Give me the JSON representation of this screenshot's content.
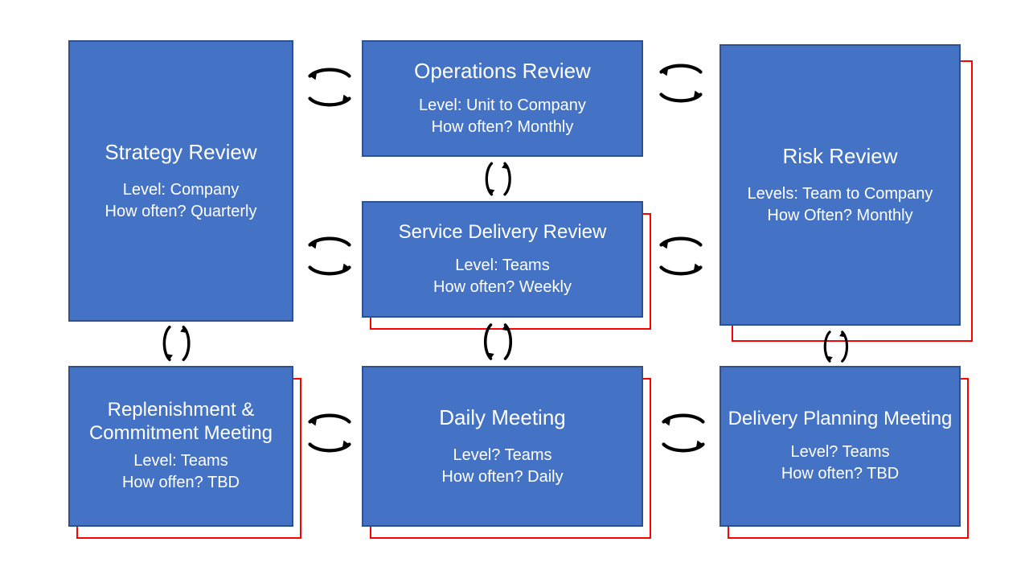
{
  "boxes": {
    "strategy": {
      "title": "Strategy Review",
      "level": "Level: Company",
      "often": "How often? Quarterly"
    },
    "operations": {
      "title": "Operations Review",
      "level": "Level: Unit to Company",
      "often": "How often? Monthly"
    },
    "service": {
      "title": "Service Delivery Review",
      "level": "Level: Teams",
      "often": "How often? Weekly"
    },
    "risk": {
      "title": "Risk Review",
      "level": "Levels: Team to Company",
      "often": "How Often? Monthly"
    },
    "replenish": {
      "title": "Replenishment & Commitment Meeting",
      "level": "Level: Teams",
      "often": "How offen? TBD"
    },
    "daily": {
      "title": "Daily Meeting",
      "level": "Level? Teams",
      "often": "How often? Daily"
    },
    "delivery": {
      "title": "Delivery Planning Meeting",
      "level": "Level? Teams",
      "often": "How often?  TBD"
    }
  }
}
